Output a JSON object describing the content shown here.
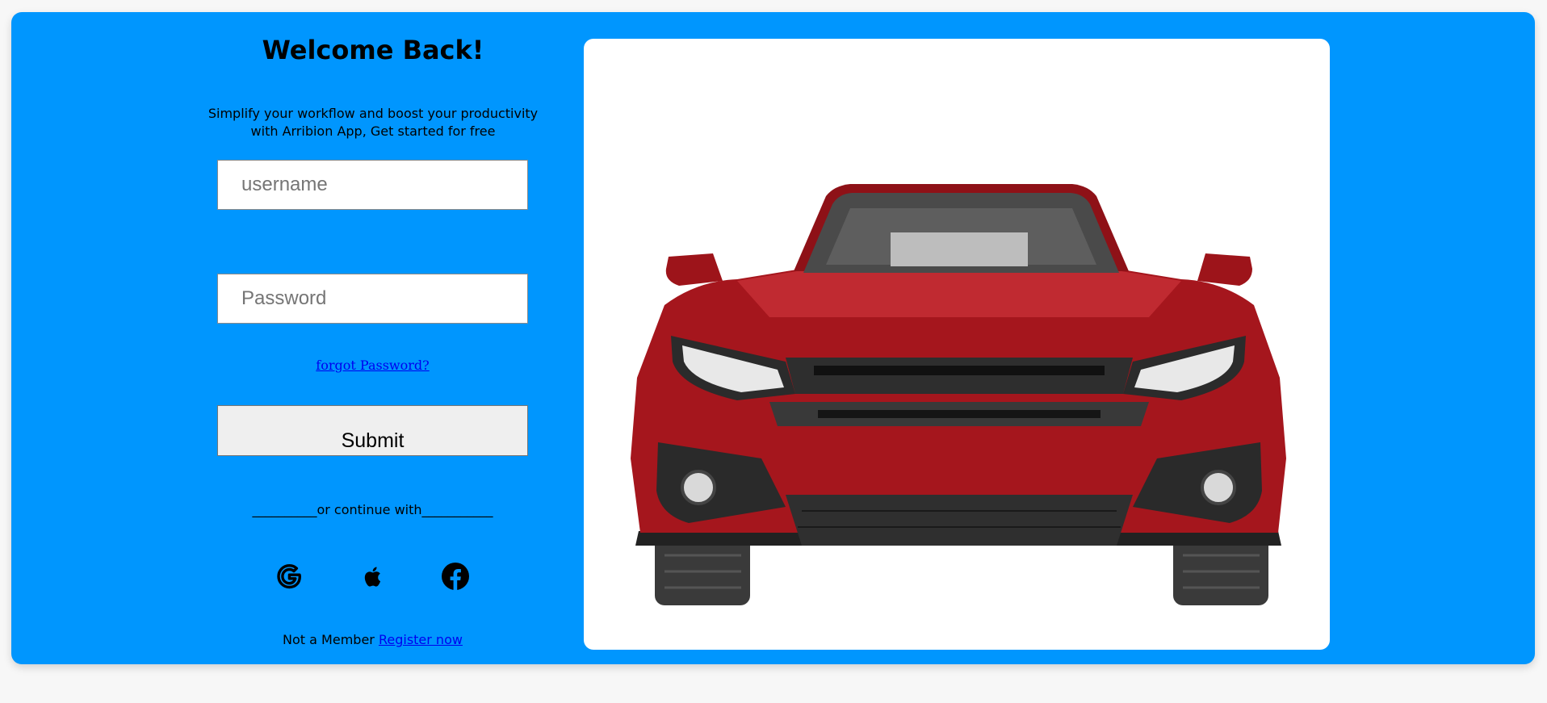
{
  "login": {
    "title": "Welcome Back!",
    "subtitle": "Simplify your workflow and boost your productivity with Arribion App, Get started for free",
    "username_placeholder": "username",
    "password_placeholder": "Password",
    "forgot_label": "forgot Password?",
    "submit_label": "Submit",
    "divider_label": "__________or continue with___________",
    "social": [
      {
        "name": "Google",
        "icon": "google-icon"
      },
      {
        "name": "Apple",
        "icon": "apple-icon"
      },
      {
        "name": "Facebook",
        "icon": "facebook-icon"
      }
    ],
    "register_prompt": "Not a Member",
    "register_link": "Register now"
  },
  "hero_image": {
    "description_icon": "red-car-image"
  },
  "colors": {
    "background": "#0096fe",
    "link": "#0000ee",
    "panel": "#ffffff"
  }
}
